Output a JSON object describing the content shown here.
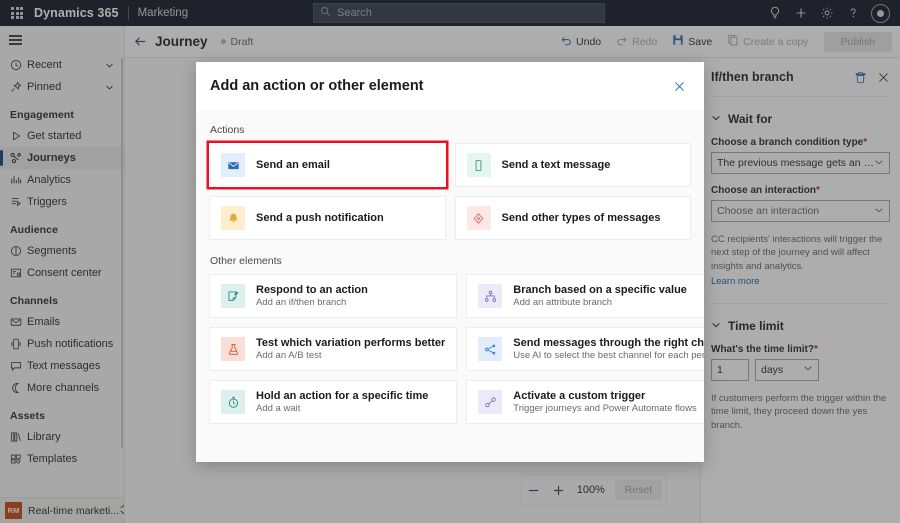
{
  "topbar": {
    "waffle_icon": "waffle-grid-icon",
    "brand": "Dynamics 365",
    "app_name": "Marketing",
    "search": {
      "placeholder": "Search",
      "icon": "search-icon"
    },
    "icons": [
      {
        "name": "lightbulb-icon",
        "glyph": "lightbulb"
      },
      {
        "name": "plus-icon",
        "glyph": "plus"
      },
      {
        "name": "gear-icon",
        "glyph": "gear"
      },
      {
        "name": "help-icon",
        "glyph": "question"
      }
    ],
    "avatar": {
      "name": "user-avatar"
    },
    "bg": "#0b1120"
  },
  "sidebar": {
    "hamburger_label": "Site map menu",
    "quick": [
      {
        "label": "Recent",
        "icon": "clock-icon",
        "chevron": "chevron-down-icon"
      },
      {
        "label": "Pinned",
        "icon": "pin-icon",
        "chevron": "chevron-down-icon"
      }
    ],
    "groups": [
      {
        "title": "Engagement",
        "items": [
          {
            "label": "Get started",
            "icon": "play-icon",
            "selected": false
          },
          {
            "label": "Journeys",
            "icon": "journeys-icon",
            "selected": true
          },
          {
            "label": "Analytics",
            "icon": "analytics-icon",
            "selected": false
          },
          {
            "label": "Triggers",
            "icon": "triggers-icon",
            "selected": false
          }
        ]
      },
      {
        "title": "Audience",
        "items": [
          {
            "label": "Segments",
            "icon": "segments-icon",
            "selected": false
          },
          {
            "label": "Consent center",
            "icon": "consent-icon",
            "selected": false
          }
        ]
      },
      {
        "title": "Channels",
        "items": [
          {
            "label": "Emails",
            "icon": "mail-icon",
            "selected": false
          },
          {
            "label": "Push notifications",
            "icon": "push-icon",
            "selected": false
          },
          {
            "label": "Text messages",
            "icon": "chat-icon",
            "selected": false
          },
          {
            "label": "More channels",
            "icon": "more-channels-icon",
            "selected": false
          }
        ]
      },
      {
        "title": "Assets",
        "items": [
          {
            "label": "Library",
            "icon": "library-icon",
            "selected": false
          },
          {
            "label": "Templates",
            "icon": "templates-icon",
            "selected": false
          }
        ]
      }
    ],
    "area_switcher": {
      "badge": "RM",
      "label": "Real-time marketi...",
      "icon": "up-down-chevron-icon"
    }
  },
  "journey_header": {
    "back_icon": "back-arrow-icon",
    "title": "Journey",
    "status": "Draft",
    "tools": [
      {
        "label": "Undo",
        "icon": "undo-icon",
        "disabled": false
      },
      {
        "label": "Redo",
        "icon": "redo-icon",
        "disabled": true
      },
      {
        "label": "Save",
        "icon": "save-icon",
        "disabled": false
      },
      {
        "label": "Create a copy",
        "icon": "copy-icon",
        "disabled": true
      }
    ],
    "publish_label": "Publish"
  },
  "modal": {
    "title": "Add an action or other element",
    "close_icon": "close-icon",
    "sections": [
      {
        "label": "Actions",
        "cards": [
          {
            "title": "Send an email",
            "subtitle": "",
            "icon": "envelope-icon",
            "tint": "#e3eefc",
            "fg": "#2b6cb0",
            "highlighted": true
          },
          {
            "title": "Send a text message",
            "subtitle": "",
            "icon": "phone-icon",
            "tint": "#e4f7ee",
            "fg": "#3aa271",
            "highlighted": false
          },
          {
            "title": "Send a push notification",
            "subtitle": "",
            "icon": "bell-icon",
            "tint": "#fdeecd",
            "fg": "#e8a33d",
            "highlighted": false
          },
          {
            "title": "Send other types of messages",
            "subtitle": "",
            "icon": "diamond-icon",
            "tint": "#fde8e6",
            "fg": "#e36b5e",
            "highlighted": false
          }
        ]
      },
      {
        "label": "Other elements",
        "cards": [
          {
            "title": "Respond to an action",
            "subtitle": "Add an if/then branch",
            "icon": "note-icon",
            "tint": "#def0ee",
            "fg": "#2e8b86",
            "highlighted": false
          },
          {
            "title": "Branch based on a specific value",
            "subtitle": "Add an attribute branch",
            "icon": "branch-icon",
            "tint": "#eceaf9",
            "fg": "#7a6ec4",
            "highlighted": false
          },
          {
            "title": "Test which variation performs better",
            "subtitle": "Add an A/B test",
            "icon": "flask-icon",
            "tint": "#fbdfd6",
            "fg": "#d4603f",
            "highlighted": false
          },
          {
            "title": "Send messages through the right channel",
            "subtitle": "Use AI to select the best channel for each person",
            "icon": "channel-ai-icon",
            "tint": "#e2edfb",
            "fg": "#3c7fd1",
            "highlighted": false
          },
          {
            "title": "Hold an action for a specific time",
            "subtitle": "Add a wait",
            "icon": "timer-icon",
            "tint": "#def0ee",
            "fg": "#2e8b86",
            "highlighted": false
          },
          {
            "title": "Activate a custom trigger",
            "subtitle": "Trigger journeys and Power Automate flows",
            "icon": "custom-trigger-icon",
            "tint": "#eceaf9",
            "fg": "#7a6ec4",
            "highlighted": false
          }
        ]
      }
    ],
    "highlight_color": "#e81123"
  },
  "right_panel": {
    "title": "If/then branch",
    "delete_icon": "trash-icon",
    "close_icon": "close-icon",
    "wait_for": {
      "section_label": "Wait for",
      "chevron": "chevron-down-icon",
      "condition_label": "Choose a branch condition type",
      "condition_required": "*",
      "condition_value": "The previous message gets an interacti...",
      "interaction_label": "Choose an interaction",
      "interaction_required": "*",
      "interaction_placeholder": "Choose an interaction",
      "help_text": "CC recipients' interactions will trigger the next step of the journey and will affect insights and analytics.",
      "learn_more": "Learn more"
    },
    "time_limit": {
      "section_label": "Time limit",
      "chevron": "chevron-down-icon",
      "label": "What's the time limit?",
      "required": "*",
      "amount": "1",
      "unit": "days",
      "help_text": "If customers perform the trigger within the time limit, they proceed down the yes branch."
    }
  },
  "zoom_control": {
    "minus_icon": "minus-icon",
    "plus_icon": "plus-icon",
    "percent": "100%",
    "reset_label": "Reset"
  }
}
